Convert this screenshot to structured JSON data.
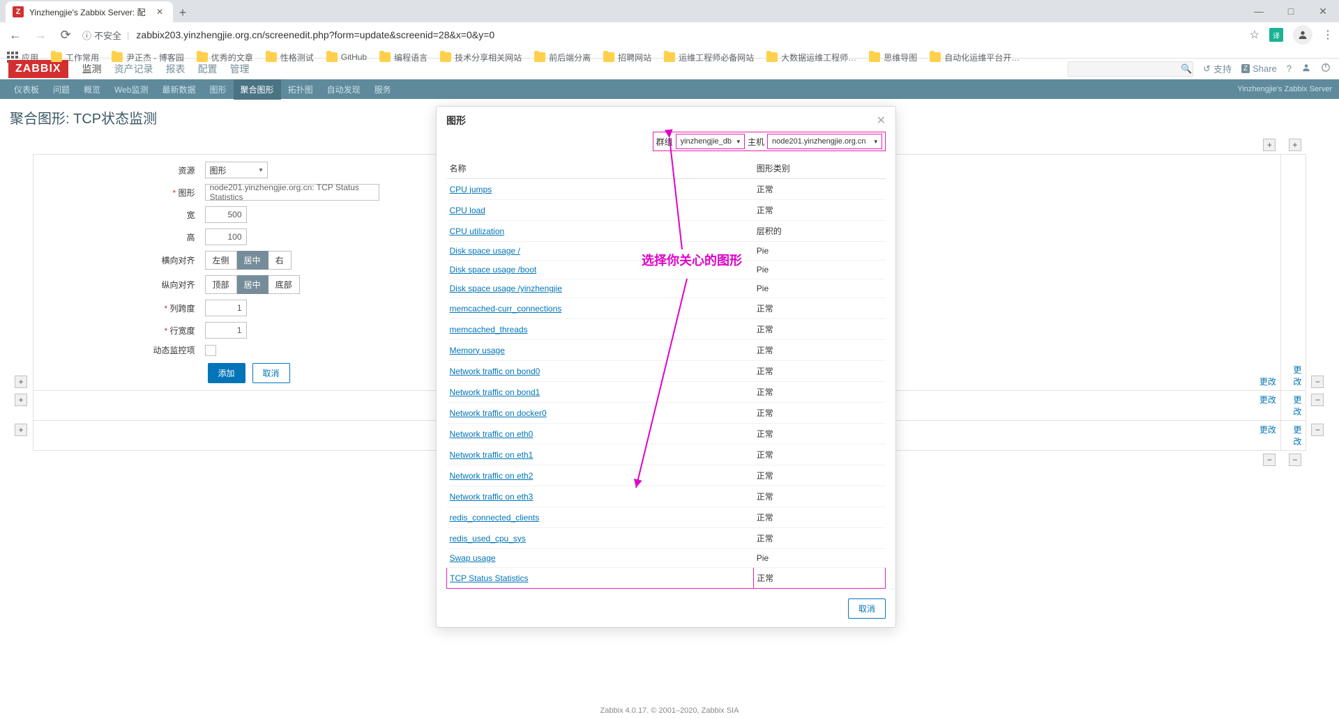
{
  "browser": {
    "tab_title": "Yinzhengjie's Zabbix Server: 配",
    "url_insecure_label": "不安全",
    "url": "zabbix203.yinzhengjie.org.cn/screenedit.php?form=update&screenid=28&x=0&y=0",
    "win": {
      "min": "—",
      "max": "□",
      "close": "✕"
    },
    "bookmarks": {
      "apps": "应用",
      "items": [
        "工作常用",
        "尹正杰 - 博客园",
        "优秀的文章",
        "性格测试",
        "GitHub",
        "编程语言",
        "技术分享相关网站",
        "前后端分离",
        "招聘网站",
        "运维工程师必备网站",
        "大数据运维工程师…",
        "思维导图",
        "自动化运维平台开…"
      ]
    }
  },
  "zbx": {
    "logo": "ZABBIX",
    "nav": [
      "监测",
      "资产记录",
      "报表",
      "配置",
      "管理"
    ],
    "nav_active_index": 0,
    "support": "支持",
    "share": "Share",
    "subnav": [
      "仪表板",
      "问题",
      "概览",
      "Web监测",
      "最新数据",
      "图形",
      "聚合图形",
      "拓扑图",
      "自动发现",
      "服务"
    ],
    "subnav_active_index": 6,
    "subnav_right": "Yinzhengjie's Zabbix Server"
  },
  "page": {
    "title": "聚合图形: TCP状态监测"
  },
  "form": {
    "resource_label": "资源",
    "resource_value": "图形",
    "graph_label": "图形",
    "graph_value": "node201.yinzhengjie.org.cn: TCP Status Statistics",
    "width_label": "宽",
    "width_value": "500",
    "height_label": "高",
    "height_value": "100",
    "halign_label": "横向对齐",
    "halign": [
      "左侧",
      "居中",
      "右"
    ],
    "halign_active": 1,
    "valign_label": "纵向对齐",
    "valign": [
      "顶部",
      "居中",
      "底部"
    ],
    "valign_active": 1,
    "colspan_label": "列跨度",
    "colspan_value": "1",
    "rowspan_label": "行宽度",
    "rowspan_value": "1",
    "dynamic_label": "动态监控项",
    "add_btn": "添加",
    "cancel_btn": "取消"
  },
  "grid": {
    "change": "更改",
    "plus": "+",
    "minus": "−"
  },
  "modal": {
    "title": "图形",
    "group_label": "群组",
    "group_value": "yinzhengjie_db",
    "host_label": "主机",
    "host_value": "node201.yinzhengjie.org.cn",
    "col_name": "名称",
    "col_type": "图形类别",
    "rows": [
      {
        "name": "CPU jumps",
        "type": "正常"
      },
      {
        "name": "CPU load",
        "type": "正常"
      },
      {
        "name": "CPU utilization",
        "type": "层积的"
      },
      {
        "name": "Disk space usage /",
        "type": "Pie"
      },
      {
        "name": "Disk space usage /boot",
        "type": "Pie"
      },
      {
        "name": "Disk space usage /yinzhengjie",
        "type": "Pie"
      },
      {
        "name": "memcached-curr_connections",
        "type": "正常"
      },
      {
        "name": "memcached_threads",
        "type": "正常"
      },
      {
        "name": "Memory usage",
        "type": "正常"
      },
      {
        "name": "Network traffic on bond0",
        "type": "正常"
      },
      {
        "name": "Network traffic on bond1",
        "type": "正常"
      },
      {
        "name": "Network traffic on docker0",
        "type": "正常"
      },
      {
        "name": "Network traffic on eth0",
        "type": "正常"
      },
      {
        "name": "Network traffic on eth1",
        "type": "正常"
      },
      {
        "name": "Network traffic on eth2",
        "type": "正常"
      },
      {
        "name": "Network traffic on eth3",
        "type": "正常"
      },
      {
        "name": "redis_connected_clients",
        "type": "正常"
      },
      {
        "name": "redis_used_cpu_sys",
        "type": "正常"
      },
      {
        "name": "Swap usage",
        "type": "Pie"
      },
      {
        "name": "TCP Status Statistics",
        "type": "正常"
      }
    ],
    "highlight_index": 19,
    "cancel": "取消"
  },
  "annotation": {
    "text": "选择你关心的图形"
  },
  "footer": "Zabbix 4.0.17. © 2001–2020, Zabbix SIA"
}
